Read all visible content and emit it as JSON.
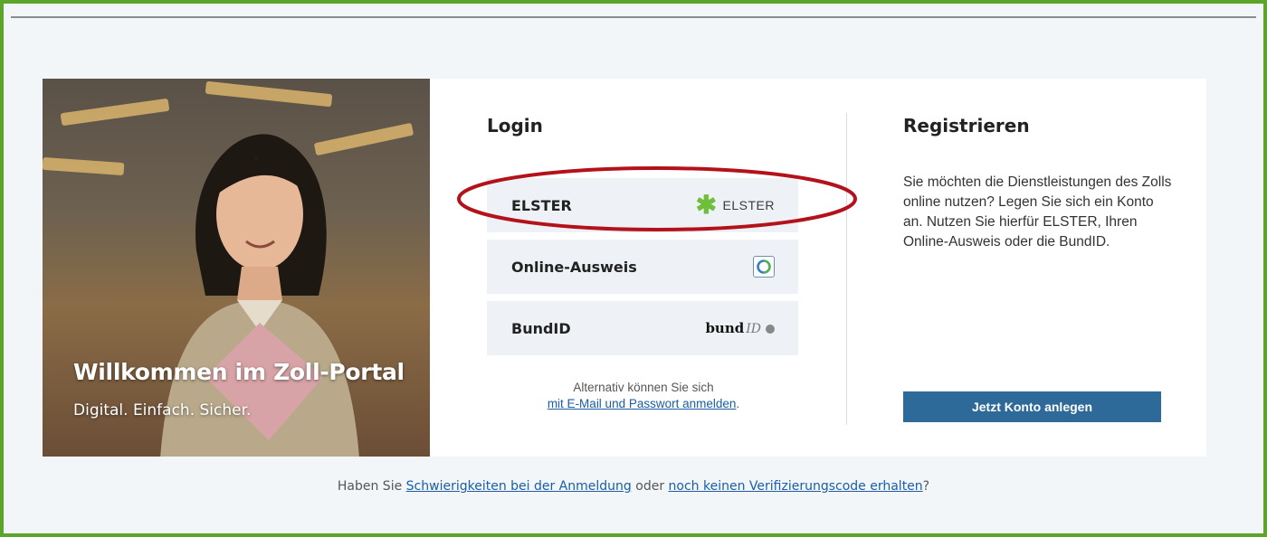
{
  "hero": {
    "title": "Willkommen im Zoll-Portal",
    "subtitle": "Digital. Einfach. Sicher."
  },
  "login": {
    "title": "Login",
    "options": [
      {
        "label": "ELSTER",
        "logo_text": "ELSTER",
        "icon": "elster-star-icon"
      },
      {
        "label": "Online-Ausweis",
        "icon": "online-ausweis-icon"
      },
      {
        "label": "BundID",
        "logo_bund": "bund",
        "logo_id": "ID",
        "icon": "bundid-logo"
      }
    ],
    "alternative_text": "Alternativ können Sie sich",
    "alternative_link": "mit E-Mail und Passwort anmelden",
    "alternative_suffix": "."
  },
  "register": {
    "title": "Registrieren",
    "text": "Sie möchten die Dienstleistungen des Zolls online nutzen? Legen Sie sich ein Konto an. Nutzen Sie hierfür ELSTER, Ihren Online-Ausweis oder die BundID.",
    "button_label": "Jetzt Konto anlegen"
  },
  "footer": {
    "prefix": "Haben Sie ",
    "link1": "Schwierigkeiten bei der Anmeldung",
    "middle": " oder ",
    "link2": "noch keinen Verifizierungscode erhalten",
    "suffix": "?"
  },
  "colors": {
    "frame_border": "#5aa52a",
    "primary_button": "#2e6a99",
    "link": "#1a5ea5",
    "highlight_ellipse": "#b3121b",
    "elster_green": "#6fbf3a"
  }
}
